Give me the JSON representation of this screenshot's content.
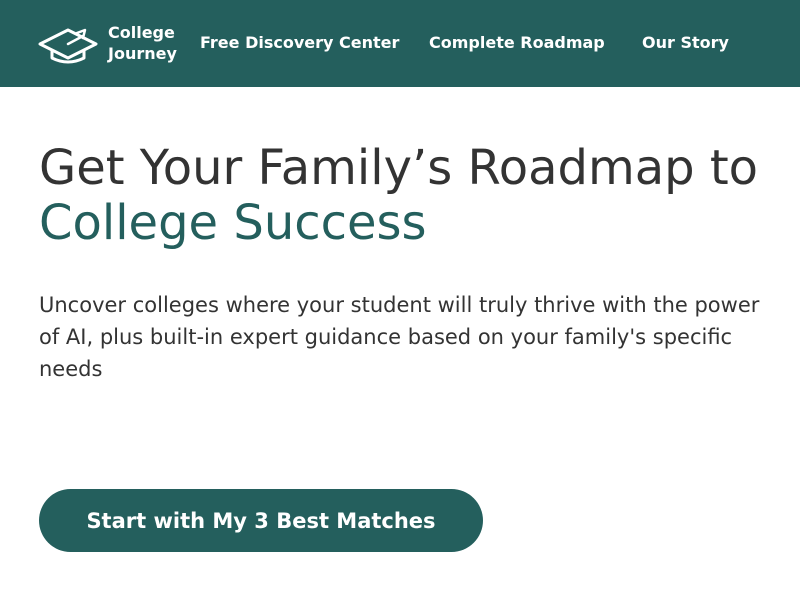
{
  "colors": {
    "brand": "#245f5d",
    "text": "#333333",
    "background": "#ffffff"
  },
  "header": {
    "logo": {
      "icon": "graduation-cap-icon",
      "line1": "College",
      "line2": "Journey"
    },
    "nav": [
      {
        "label": "Free Discovery Center"
      },
      {
        "label": "Complete Roadmap"
      },
      {
        "label": "Our Story"
      }
    ]
  },
  "hero": {
    "headline_line1": "Get Your Family’s Roadmap to",
    "headline_accent": "College Success",
    "subtitle": "Uncover colleges where your student will truly thrive with the power of AI, plus built-in expert guidance based on your family's specific needs",
    "cta_label": "Start with My 3 Best Matches"
  }
}
